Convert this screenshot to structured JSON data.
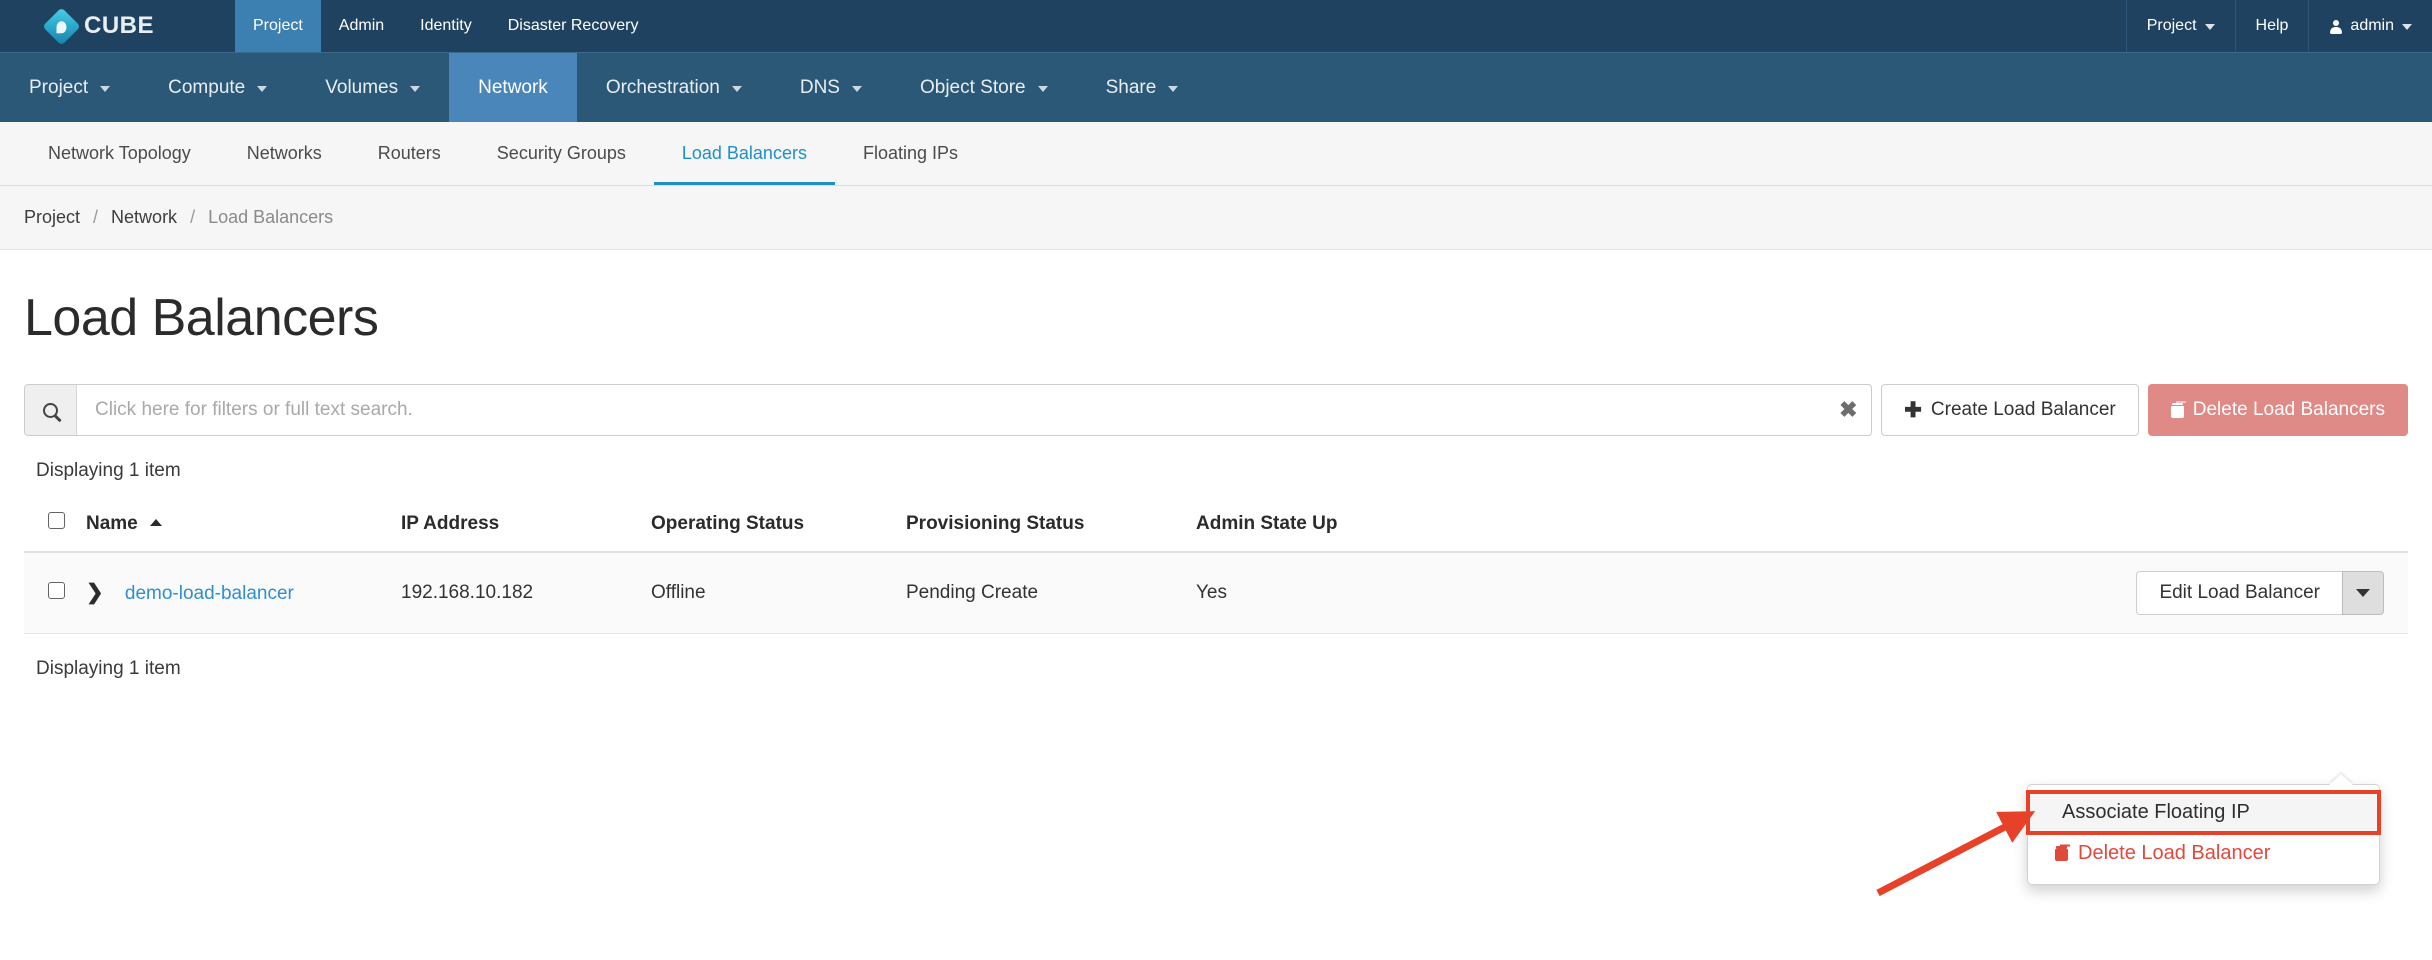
{
  "topbar": {
    "brand": "CUBE",
    "brand_icon": "cube-diamond-logo",
    "nav": [
      {
        "label": "Project",
        "active": true
      },
      {
        "label": "Admin",
        "active": false
      },
      {
        "label": "Identity",
        "active": false
      },
      {
        "label": "Disaster Recovery",
        "active": false
      }
    ],
    "right": [
      {
        "label": "Project",
        "caret": true,
        "icon": null
      },
      {
        "label": "Help",
        "caret": false,
        "icon": null
      },
      {
        "label": "admin",
        "caret": true,
        "icon": "user-icon"
      }
    ]
  },
  "nav2": [
    {
      "label": "Project",
      "caret": true,
      "active": false
    },
    {
      "label": "Compute",
      "caret": true,
      "active": false
    },
    {
      "label": "Volumes",
      "caret": true,
      "active": false
    },
    {
      "label": "Network",
      "caret": false,
      "active": true
    },
    {
      "label": "Orchestration",
      "caret": true,
      "active": false
    },
    {
      "label": "DNS",
      "caret": true,
      "active": false
    },
    {
      "label": "Object Store",
      "caret": true,
      "active": false
    },
    {
      "label": "Share",
      "caret": true,
      "active": false
    }
  ],
  "nav3": [
    {
      "label": "Network Topology",
      "active": false
    },
    {
      "label": "Networks",
      "active": false
    },
    {
      "label": "Routers",
      "active": false
    },
    {
      "label": "Security Groups",
      "active": false
    },
    {
      "label": "Load Balancers",
      "active": true
    },
    {
      "label": "Floating IPs",
      "active": false
    }
  ],
  "breadcrumb": {
    "items": [
      "Project",
      "Network",
      "Load Balancers"
    ],
    "separator": "/"
  },
  "page": {
    "title": "Load Balancers"
  },
  "search": {
    "placeholder": "Click here for filters or full text search.",
    "value": "",
    "icon": "search-icon",
    "clear_label": "✖"
  },
  "actions": {
    "create_label": "Create Load Balancer",
    "create_icon": "plus-icon",
    "delete_label": "Delete Load Balancers",
    "delete_icon": "trash-icon"
  },
  "table": {
    "count_text_top": "Displaying 1 item",
    "count_text_bottom": "Displaying 1 item",
    "sort_column": "Name",
    "sort_direction": "asc",
    "columns": [
      "Name",
      "IP Address",
      "Operating Status",
      "Provisioning Status",
      "Admin State Up"
    ],
    "rows": [
      {
        "name": "demo-load-balancer",
        "ip_address": "192.168.10.182",
        "operating_status": "Offline",
        "provisioning_status": "Pending Create",
        "admin_state_up": "Yes",
        "action_label": "Edit Load Balancer"
      }
    ]
  },
  "dropdown": {
    "items": [
      {
        "label": "Associate Floating IP",
        "highlighted": true,
        "icon": null
      },
      {
        "label": "Delete Load Balancer",
        "highlighted": false,
        "icon": "trash-icon"
      }
    ]
  },
  "annotation": {
    "arrow_color": "#e8412a",
    "highlight_color": "#e8412a"
  },
  "colors": {
    "topbar_bg": "#1f4260",
    "nav2_bg": "#2b5877",
    "nav2_active": "#4a86ba",
    "link": "#2f8fd0",
    "danger": "#e08a87",
    "delete_text": "#e0493c"
  }
}
